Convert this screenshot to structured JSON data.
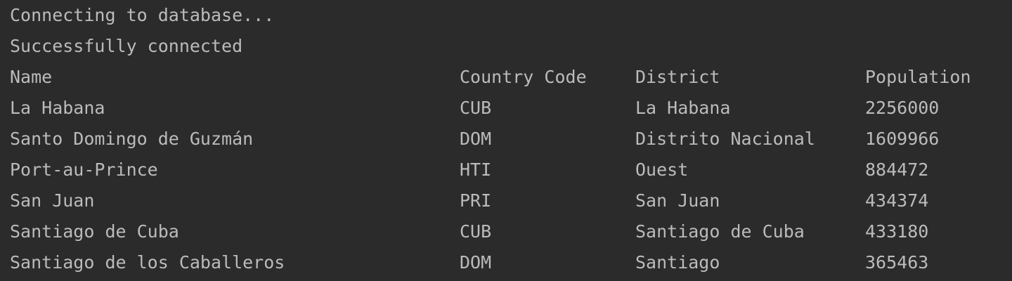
{
  "console": {
    "messages": [
      "Connecting to database...",
      "Successfully connected"
    ],
    "headers": {
      "name": "Name",
      "country_code": "Country Code",
      "district": "District",
      "population": "Population"
    },
    "rows": [
      {
        "name": "La Habana",
        "country_code": "CUB",
        "district": "La Habana",
        "population": "2256000"
      },
      {
        "name": "Santo Domingo de Guzmán",
        "country_code": "DOM",
        "district": "Distrito Nacional",
        "population": "1609966"
      },
      {
        "name": "Port-au-Prince",
        "country_code": "HTI",
        "district": "Ouest",
        "population": "884472"
      },
      {
        "name": "San Juan",
        "country_code": "PRI",
        "district": "San Juan",
        "population": "434374"
      },
      {
        "name": "Santiago de Cuba",
        "country_code": "CUB",
        "district": "Santiago de Cuba",
        "population": "433180"
      },
      {
        "name": "Santiago de los Caballeros",
        "country_code": "DOM",
        "district": "Santiago",
        "population": "365463"
      }
    ]
  },
  "colors": {
    "background": "#2b2b2b",
    "text": "#bbbbbb"
  }
}
